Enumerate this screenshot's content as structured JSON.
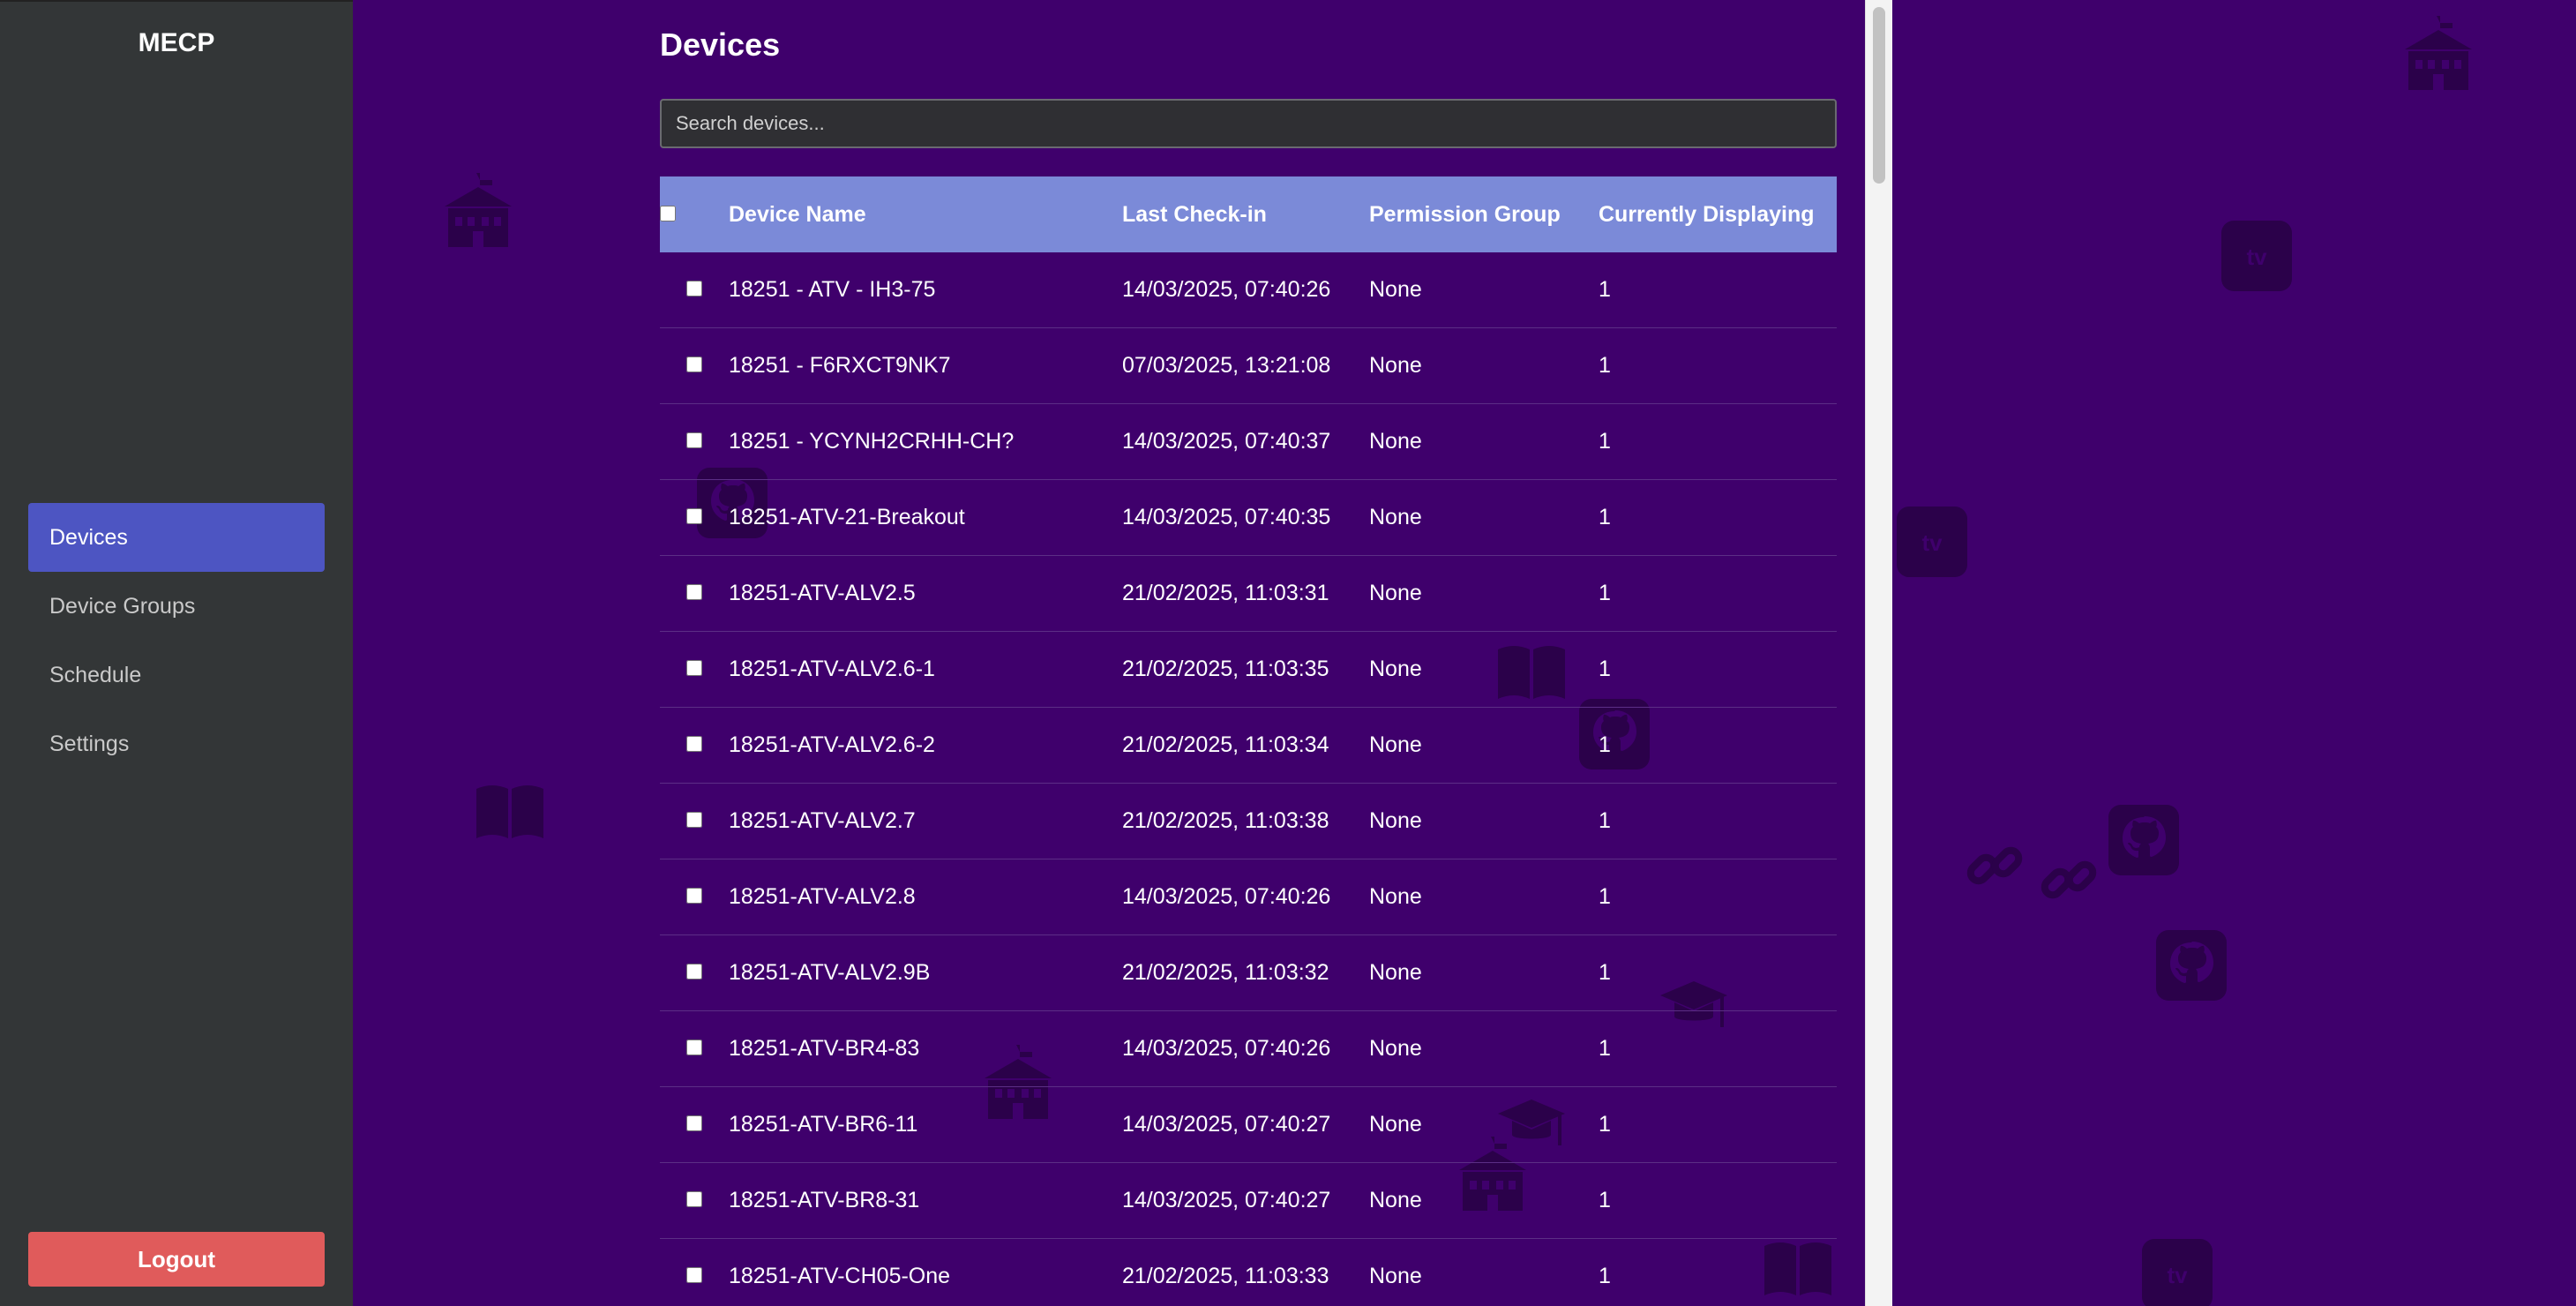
{
  "app": {
    "brand": "MECP"
  },
  "sidebar": {
    "items": [
      {
        "label": "Devices",
        "active": true
      },
      {
        "label": "Device Groups",
        "active": false
      },
      {
        "label": "Schedule",
        "active": false
      },
      {
        "label": "Settings",
        "active": false
      }
    ],
    "logout_label": "Logout"
  },
  "page": {
    "title": "Devices",
    "search_placeholder": "Search devices..."
  },
  "table": {
    "headers": [
      "Device Name",
      "Last Check-in",
      "Permission Group",
      "Currently Displaying"
    ],
    "rows": [
      {
        "name": "18251 - ATV - IH3-75",
        "last_checkin": "14/03/2025, 07:40:26",
        "group": "None",
        "displaying": "1"
      },
      {
        "name": "18251 - F6RXCT9NK7",
        "last_checkin": "07/03/2025, 13:21:08",
        "group": "None",
        "displaying": "1"
      },
      {
        "name": "18251 - YCYNH2CRHH-CH?",
        "last_checkin": "14/03/2025, 07:40:37",
        "group": "None",
        "displaying": "1"
      },
      {
        "name": "18251-ATV-21-Breakout",
        "last_checkin": "14/03/2025, 07:40:35",
        "group": "None",
        "displaying": "1"
      },
      {
        "name": "18251-ATV-ALV2.5",
        "last_checkin": "21/02/2025, 11:03:31",
        "group": "None",
        "displaying": "1"
      },
      {
        "name": "18251-ATV-ALV2.6-1",
        "last_checkin": "21/02/2025, 11:03:35",
        "group": "None",
        "displaying": "1"
      },
      {
        "name": "18251-ATV-ALV2.6-2",
        "last_checkin": "21/02/2025, 11:03:34",
        "group": "None",
        "displaying": "1"
      },
      {
        "name": "18251-ATV-ALV2.7",
        "last_checkin": "21/02/2025, 11:03:38",
        "group": "None",
        "displaying": "1"
      },
      {
        "name": "18251-ATV-ALV2.8",
        "last_checkin": "14/03/2025, 07:40:26",
        "group": "None",
        "displaying": "1"
      },
      {
        "name": "18251-ATV-ALV2.9B",
        "last_checkin": "21/02/2025, 11:03:32",
        "group": "None",
        "displaying": "1"
      },
      {
        "name": "18251-ATV-BR4-83",
        "last_checkin": "14/03/2025, 07:40:26",
        "group": "None",
        "displaying": "1"
      },
      {
        "name": "18251-ATV-BR6-11",
        "last_checkin": "14/03/2025, 07:40:27",
        "group": "None",
        "displaying": "1"
      },
      {
        "name": "18251-ATV-BR8-31",
        "last_checkin": "14/03/2025, 07:40:27",
        "group": "None",
        "displaying": "1"
      },
      {
        "name": "18251-ATV-CH05-One",
        "last_checkin": "21/02/2025, 11:03:33",
        "group": "None",
        "displaying": "1"
      }
    ]
  },
  "background": {
    "decorations": [
      {
        "icon": "school-icon",
        "label": ""
      },
      {
        "icon": "apple-tv-icon",
        "label": "tv"
      },
      {
        "icon": "book-icon",
        "label": ""
      },
      {
        "icon": "github-icon",
        "label": ""
      },
      {
        "icon": "link-icon",
        "label": ""
      },
      {
        "icon": "graduation-cap-icon",
        "label": ""
      }
    ]
  },
  "colors": {
    "background": "#3f006c",
    "sidebar": "#333637",
    "active_nav": "#4d55c2",
    "table_header": "#7b8ad8",
    "logout": "#e05b5b"
  }
}
